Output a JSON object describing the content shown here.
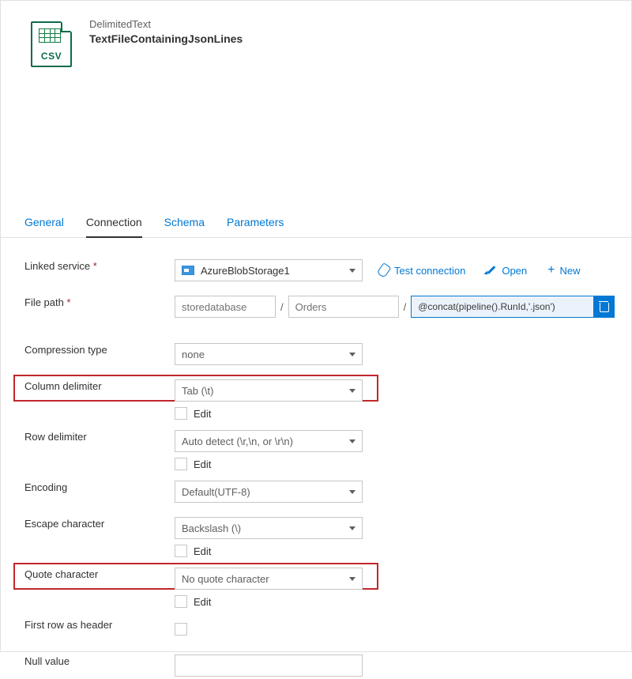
{
  "header": {
    "icon_label": "CSV",
    "type": "DelimitedText",
    "name": "TextFileContainingJsonLines"
  },
  "tabs": {
    "general": "General",
    "connection": "Connection",
    "schema": "Schema",
    "parameters": "Parameters"
  },
  "labels": {
    "linked_service": "Linked service",
    "file_path": "File path",
    "compression_type": "Compression type",
    "column_delimiter": "Column delimiter",
    "row_delimiter": "Row delimiter",
    "encoding": "Encoding",
    "escape_character": "Escape character",
    "quote_character": "Quote character",
    "first_row_header": "First row as header",
    "null_value": "Null value",
    "edit": "Edit"
  },
  "values": {
    "linked_service": "AzureBlobStorage1",
    "path1": "storedatabase",
    "path2": "Orders",
    "path3": "@concat(pipeline().RunId,'.json')",
    "compression_type": "none",
    "column_delimiter": "Tab (\\t)",
    "row_delimiter": "Auto detect (\\r,\\n, or \\r\\n)",
    "encoding": "Default(UTF-8)",
    "escape_character": "Backslash (\\)",
    "quote_character": "No quote character"
  },
  "actions": {
    "test_connection": "Test connection",
    "open": "Open",
    "new": "New"
  }
}
